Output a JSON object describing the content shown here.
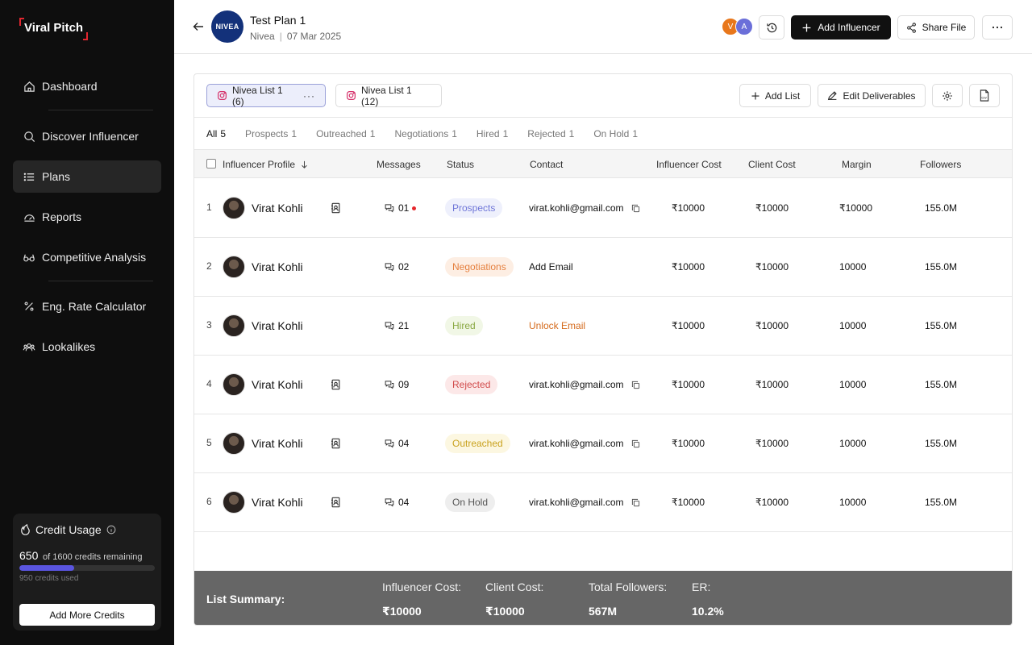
{
  "sidebar": {
    "logo": "Viral Pitch",
    "items": [
      {
        "label": "Dashboard",
        "icon": "home-icon"
      },
      {
        "label": "Discover Influencer",
        "icon": "search-icon"
      },
      {
        "label": "Plans",
        "icon": "list-icon",
        "active": true
      },
      {
        "label": "Reports",
        "icon": "gauge-icon"
      },
      {
        "label": "Competitive Analysis",
        "icon": "glasses-icon"
      },
      {
        "label": "Eng. Rate Calculator",
        "icon": "percent-icon"
      },
      {
        "label": "Lookalikes",
        "icon": "users-icon"
      }
    ],
    "credit": {
      "title": "Credit Usage",
      "remaining": "650",
      "remaining_text": "of 1600 credits remaining",
      "used_text": "950 credits used",
      "progress_fraction": 0.406,
      "button": "Add More Credits"
    }
  },
  "header": {
    "brand_logo_text": "NIVEA",
    "title": "Test Plan 1",
    "brand": "Nivea",
    "date": "07 Mar 2025",
    "avatars": [
      {
        "initial": "V",
        "color": "#e8771b"
      },
      {
        "initial": "A",
        "color": "#6b6fd9"
      }
    ],
    "add_influencer": "Add Influencer",
    "share_file": "Share File"
  },
  "lists": [
    {
      "label": "Nivea List 1 (6)",
      "active": true
    },
    {
      "label": "Nivea List 1 (12)",
      "active": false
    }
  ],
  "actions": {
    "add_list": "Add List",
    "edit_deliverables": "Edit Deliverables"
  },
  "filters": [
    {
      "label": "All",
      "count": "5",
      "active": true
    },
    {
      "label": "Prospects",
      "count": "1"
    },
    {
      "label": "Outreached",
      "count": "1"
    },
    {
      "label": "Negotiations",
      "count": "1"
    },
    {
      "label": "Hired",
      "count": "1"
    },
    {
      "label": "Rejected",
      "count": "1"
    },
    {
      "label": "On Hold",
      "count": "1"
    }
  ],
  "columns": {
    "profile": "Influencer Profile",
    "messages": "Messages",
    "status": "Status",
    "contact": "Contact",
    "influencer_cost": "Influencer Cost",
    "client_cost": "Client Cost",
    "margin": "Margin",
    "followers": "Followers"
  },
  "rows": [
    {
      "num": "1",
      "name": "Virat Kohli",
      "has_contact_icon": true,
      "messages": "01",
      "unread": true,
      "status": "Prospects",
      "status_key": "prospects",
      "contact": "virat.kohli@gmail.com",
      "contact_type": "email",
      "influencer_cost": "₹10000",
      "client_cost": "₹10000",
      "margin": "₹10000",
      "followers": "155.0M"
    },
    {
      "num": "2",
      "name": "Virat Kohli",
      "has_contact_icon": false,
      "messages": "02",
      "unread": false,
      "status": "Negotiations",
      "status_key": "negotiations",
      "contact": "Add Email",
      "contact_type": "add",
      "influencer_cost": "₹10000",
      "client_cost": "₹10000",
      "margin": "10000",
      "followers": "155.0M"
    },
    {
      "num": "3",
      "name": "Virat Kohli",
      "has_contact_icon": false,
      "messages": "21",
      "unread": false,
      "status": "Hired",
      "status_key": "hired",
      "contact": "Unlock Email",
      "contact_type": "unlock",
      "influencer_cost": "₹10000",
      "client_cost": "₹10000",
      "margin": "10000",
      "followers": "155.0M"
    },
    {
      "num": "4",
      "name": "Virat Kohli",
      "has_contact_icon": true,
      "messages": "09",
      "unread": false,
      "status": "Rejected",
      "status_key": "rejected",
      "contact": "virat.kohli@gmail.com",
      "contact_type": "email",
      "influencer_cost": "₹10000",
      "client_cost": "₹10000",
      "margin": "10000",
      "followers": "155.0M"
    },
    {
      "num": "5",
      "name": "Virat Kohli",
      "has_contact_icon": true,
      "messages": "04",
      "unread": false,
      "status": "Outreached",
      "status_key": "outreached",
      "contact": "virat.kohli@gmail.com",
      "contact_type": "email",
      "influencer_cost": "₹10000",
      "client_cost": "₹10000",
      "margin": "10000",
      "followers": "155.0M"
    },
    {
      "num": "6",
      "name": "Virat Kohli",
      "has_contact_icon": true,
      "messages": "04",
      "unread": false,
      "status": "On Hold",
      "status_key": "onhold",
      "contact": "virat.kohli@gmail.com",
      "contact_type": "email",
      "influencer_cost": "₹10000",
      "client_cost": "₹10000",
      "margin": "10000",
      "followers": "155.0M"
    }
  ],
  "summary": {
    "label": "List Summary:",
    "items": [
      {
        "key": "Influencer Cost:",
        "value": "₹10000"
      },
      {
        "key": "Client Cost:",
        "value": "₹10000"
      },
      {
        "key": "Total Followers:",
        "value": "567M"
      },
      {
        "key": "ER:",
        "value": "10.2%"
      }
    ]
  }
}
